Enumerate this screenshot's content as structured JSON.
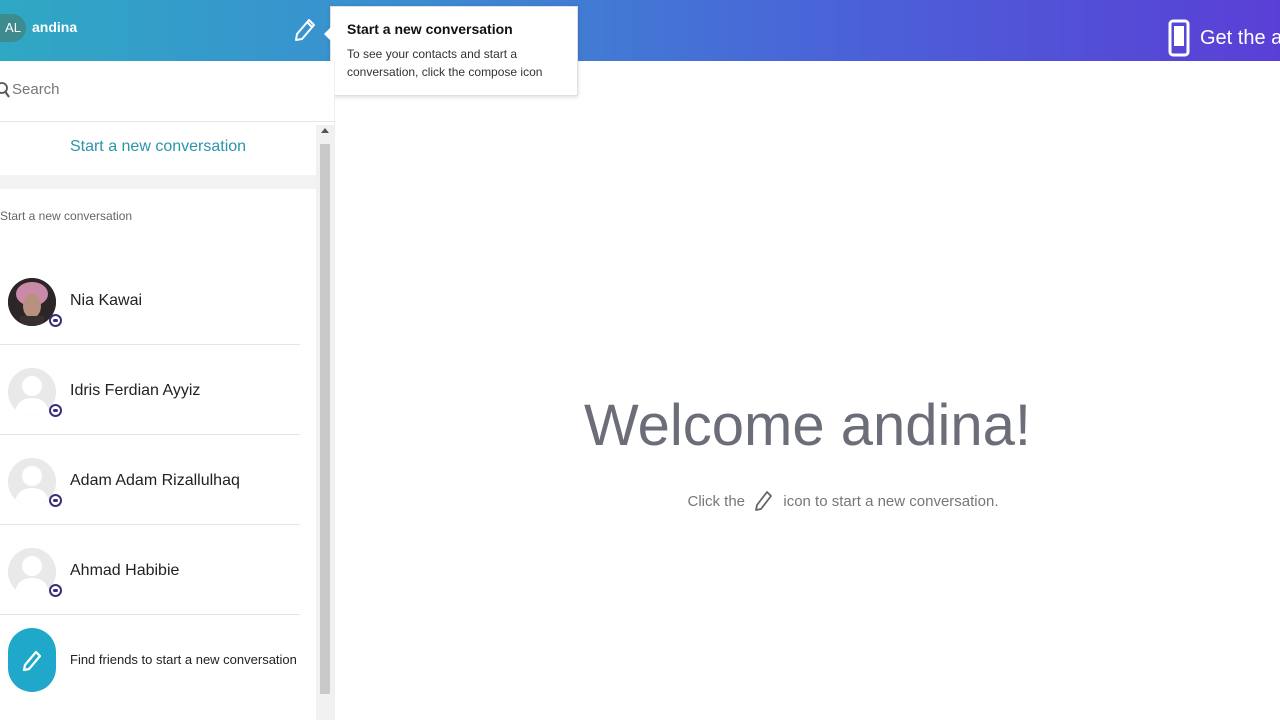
{
  "header": {
    "user_initials": "AL",
    "user_name": "andina",
    "get_app_label": "Get the app"
  },
  "tooltip": {
    "title": "Start a new conversation",
    "text": "To see your contacts and start a conversation, click the compose icon"
  },
  "sidebar": {
    "search_placeholder": "Search",
    "start_link": "Start a new conversation",
    "section_label": "Start a new conversation",
    "contacts": [
      {
        "name": "Nia Kawai"
      },
      {
        "name": "Idris Ferdian Ayyiz"
      },
      {
        "name": "Adam Adam Rizallulhaq"
      },
      {
        "name": "Ahmad Habibie"
      }
    ],
    "find_friends": "Find friends to start a new conversation"
  },
  "main": {
    "welcome": "Welcome andina!",
    "hint_before": "Click the",
    "hint_after": "icon to start a new conversation."
  },
  "colors": {
    "accent": "#2b95a9",
    "find_button": "#1fa8c9",
    "status_ring": "#3a2f7a"
  },
  "icons": [
    "compose-icon",
    "phone-icon",
    "search-icon",
    "user-silhouette-icon",
    "pencil-icon"
  ]
}
